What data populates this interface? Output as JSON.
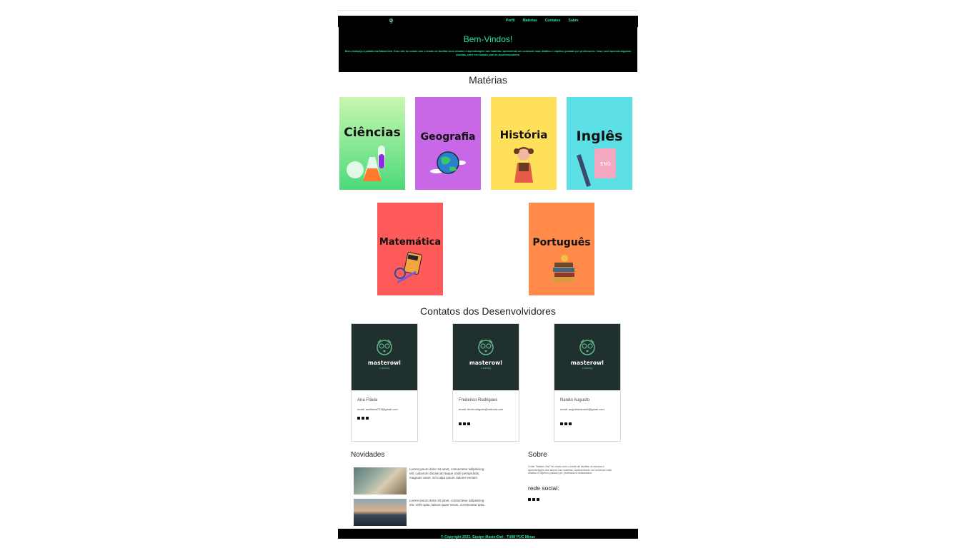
{
  "nav": {
    "links": [
      "Perfil",
      "Matérias",
      "Contatos",
      "Sobre"
    ]
  },
  "hero": {
    "title": "Bem-Vindos!",
    "text": "Bem vindo(a)s a plataforma MasterOwl. Esse site foi criado com o intuito de facilitar seus estudos e aprendizagem nas matérias, aprendendo um conteúdo mais didático e objetivo postado por professores. Caso você aprenda algumas dúvidas, entre em contato com os desenvolvedores."
  },
  "subjects": {
    "title": "Matérias",
    "items": [
      {
        "name": "Ciências",
        "color": "#4cd97a"
      },
      {
        "name": "Geografia",
        "color": "#c868e6"
      },
      {
        "name": "História",
        "color": "#ffe05a"
      },
      {
        "name": "Inglês",
        "color": "#5ddfe6"
      },
      {
        "name": "Matemática",
        "color": "#ff5a5a"
      },
      {
        "name": "Português",
        "color": "#ff8a4a"
      }
    ]
  },
  "contacts": {
    "title": "Contatos dos Desenvolvidores",
    "brand": "masterowl",
    "brand_tag": "e-learning",
    "devs": [
      {
        "name": "Ana Flávia",
        "email": "email: anaflavia713@gmail.com"
      },
      {
        "name": "Frederico Rodrigues",
        "email": "email: fredrrodrigues@outlook.com"
      },
      {
        "name": "Nando Augusto",
        "email": "email: augustonando5@gmail.com"
      }
    ]
  },
  "news": {
    "title": "Novidades",
    "items": [
      {
        "text": "Lorem ipsum dolor sit amet, consectetur adipisicing elit. Laborum obcaecati itaque unde perspiciatis, magnam amet, vel culpa ipsum ratione veniam."
      },
      {
        "text": "Lorem ipsum dolor sit amet, consectetur adipisicing elit. Velit optio, labore quae rerum, consectetur ipsa."
      }
    ]
  },
  "about": {
    "title": "Sobre",
    "text": "O site \"Master-Owl\" foi criado com o intuito de facilitar os estudos e aprendizagem dos alunos nas matérias, apresentando um conteúdo mais didático e objetivo postado por professores cadastrados.",
    "social_title": "rede social:"
  },
  "footer": {
    "text": "© Copyright 2021- Equipe MasterOwl - TIAW PUC Minas"
  },
  "colors": {
    "accent": "#27e6a8",
    "dark": "#000000",
    "card_bg": "#20302e"
  }
}
